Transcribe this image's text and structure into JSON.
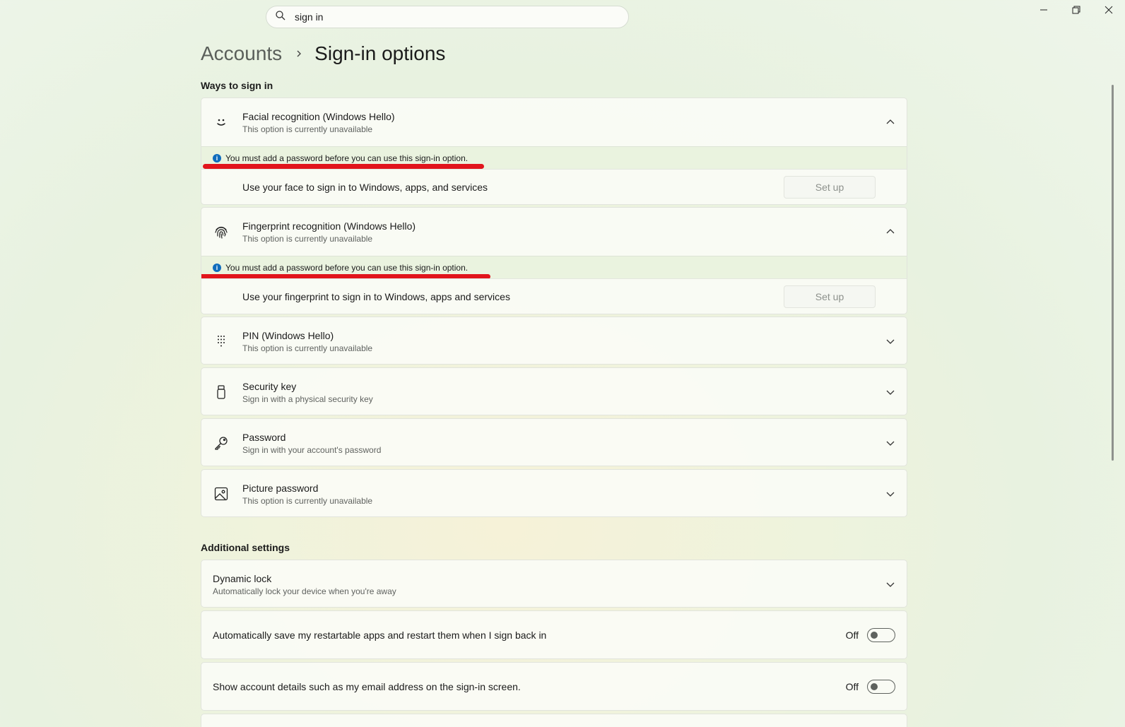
{
  "search": {
    "value": "sign in",
    "icon": "search-icon"
  },
  "window_controls": {
    "minimize": "minimize-icon",
    "restore": "restore-icon",
    "close": "close-icon"
  },
  "breadcrumb": {
    "parent": "Accounts",
    "current": "Sign-in options"
  },
  "ways_section": {
    "title": "Ways to sign in",
    "items": [
      {
        "title": "Facial recognition (Windows Hello)",
        "subtitle": "This option is currently unavailable",
        "icon": "face-icon",
        "expanded": true,
        "info": "You must add a password before you can use this sign-in option.",
        "detail": "Use your face to sign in to Windows, apps, and services",
        "button": "Set up"
      },
      {
        "title": "Fingerprint recognition (Windows Hello)",
        "subtitle": "This option is currently unavailable",
        "icon": "fingerprint-icon",
        "expanded": true,
        "info": "You must add a password before you can use this sign-in option.",
        "detail": "Use your fingerprint to sign in to Windows, apps and services",
        "button": "Set up"
      },
      {
        "title": "PIN (Windows Hello)",
        "subtitle": "This option is currently unavailable",
        "icon": "keypad-icon"
      },
      {
        "title": "Security key",
        "subtitle": "Sign in with a physical security key",
        "icon": "usb-key-icon"
      },
      {
        "title": "Password",
        "subtitle": "Sign in with your account's password",
        "icon": "key-icon"
      },
      {
        "title": "Picture password",
        "subtitle": "This option is currently unavailable",
        "icon": "picture-icon"
      }
    ]
  },
  "additional_section": {
    "title": "Additional settings",
    "dynamic_lock": {
      "title": "Dynamic lock",
      "subtitle": "Automatically lock your device when you're away"
    },
    "toggles": [
      {
        "label": "Automatically save my restartable apps and restart them when I sign back in",
        "state": "Off"
      },
      {
        "label": "Show account details such as my email address on the sign-in screen.",
        "state": "Off"
      }
    ]
  },
  "colors": {
    "accent": "#0f6cbd",
    "annotation": "#e1141c"
  }
}
